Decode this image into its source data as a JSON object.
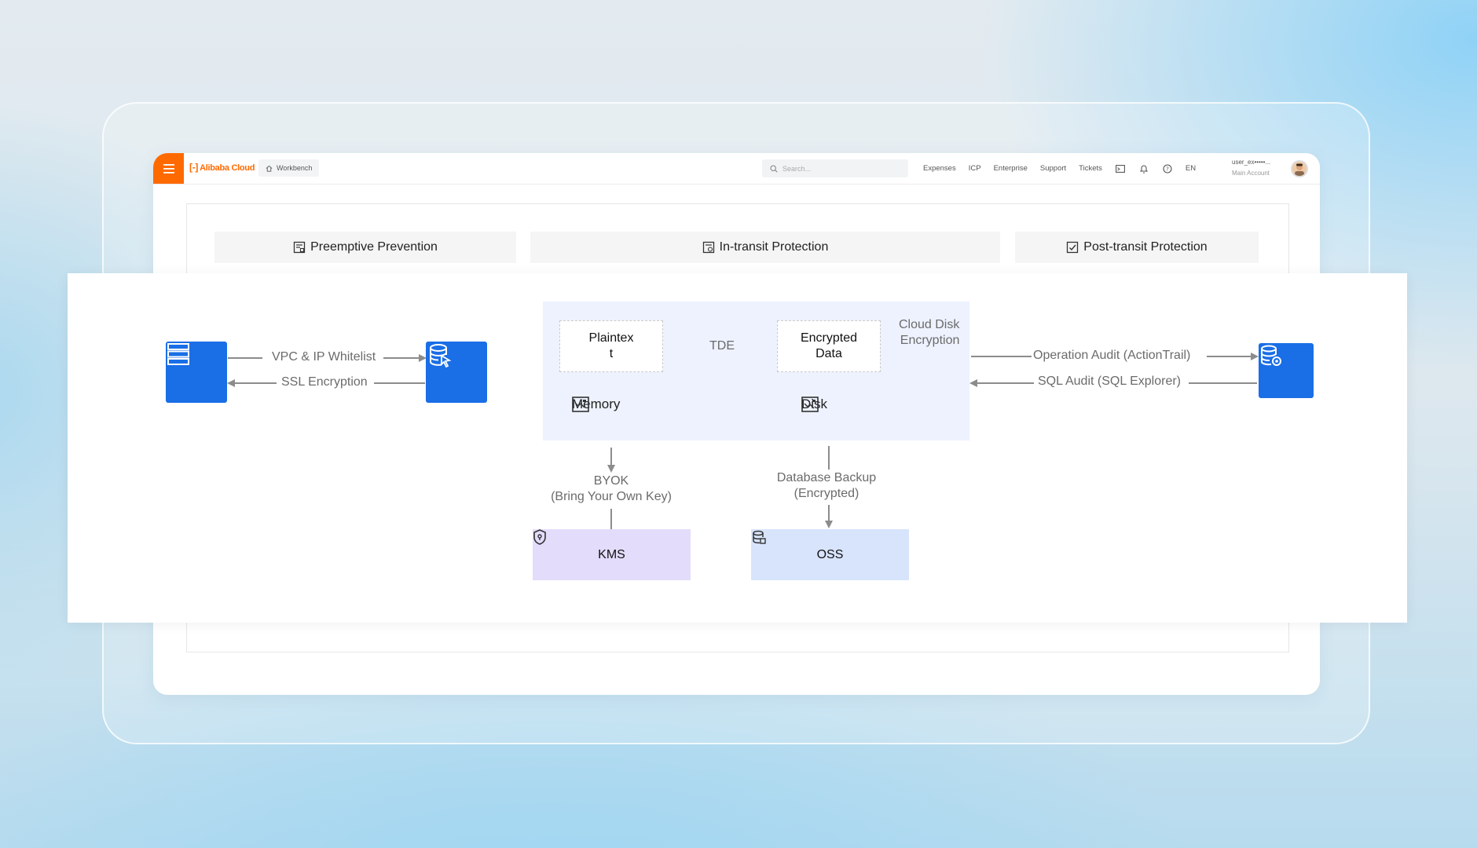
{
  "topbar": {
    "brand": "Alibaba Cloud",
    "workbench": "Workbench",
    "search_placeholder": "Search...",
    "nav": [
      "Expenses",
      "ICP",
      "Enterprise",
      "Support",
      "Tickets"
    ],
    "lang": "EN",
    "account_name": "user_ex•••••...",
    "account_type": "Main Account"
  },
  "phases": {
    "preemptive": "Preemptive Prevention",
    "in_transit": "In-transit Protection",
    "post_transit": "Post-transit Protection"
  },
  "diagram": {
    "vpc_whitelist": "VPC & IP Whitelist",
    "ssl_encryption": "SSL Encryption",
    "plaintext": "Plaintex\nt",
    "tde": "TDE",
    "encrypted_data": "Encrypted\nData",
    "cloud_disk_encryption": "Cloud Disk\nEncryption",
    "memory": "Memory",
    "disk": "Disk",
    "byok": "BYOK\n(Bring Your Own Key)",
    "database_backup": "Database Backup\n(Encrypted)",
    "kms": "KMS",
    "oss": "OSS",
    "operation_audit": "Operation Audit (ActionTrail)",
    "sql_audit": "SQL Audit (SQL Explorer)"
  },
  "colors": {
    "brand_orange": "#ff6a00",
    "icon_blue": "#1a6ee6",
    "encryption_area": "#edf2fe",
    "kms_box": "#e3dcfb",
    "oss_box": "#d8e4fc",
    "arrow_gray": "#8c8c8c"
  }
}
